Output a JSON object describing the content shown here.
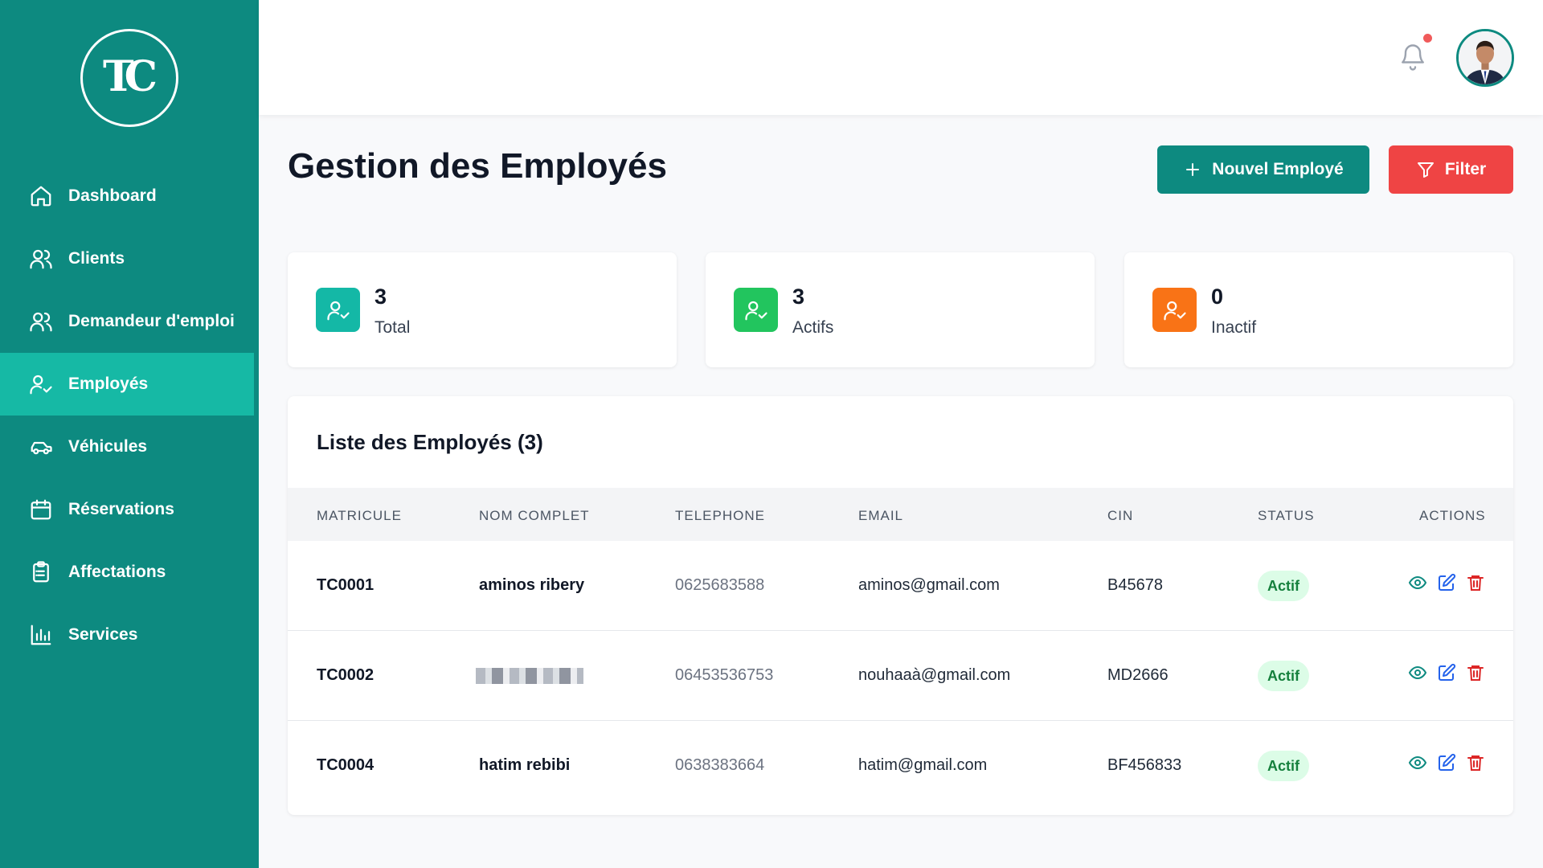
{
  "brand": {
    "logo_text": "TC"
  },
  "sidebar": {
    "items": [
      {
        "label": "Dashboard",
        "icon": "home-icon"
      },
      {
        "label": "Clients",
        "icon": "users-icon"
      },
      {
        "label": "Demandeur d'emploi",
        "icon": "users-icon"
      },
      {
        "label": "Employés",
        "icon": "user-check-icon",
        "active": true
      },
      {
        "label": "Véhicules",
        "icon": "car-icon"
      },
      {
        "label": "Réservations",
        "icon": "calendar-icon"
      },
      {
        "label": "Affectations",
        "icon": "clipboard-list-icon"
      },
      {
        "label": "Services",
        "icon": "bar-chart-icon"
      }
    ]
  },
  "header": {
    "notification_icon": "bell-icon",
    "has_notification": true
  },
  "page": {
    "title": "Gestion des Employés",
    "new_button_label": "Nouvel Employé",
    "filter_button_label": "Filter"
  },
  "stats": [
    {
      "value": "3",
      "label": "Total",
      "color": "#14b8a6"
    },
    {
      "value": "3",
      "label": "Actifs",
      "color": "#22c55e"
    },
    {
      "value": "0",
      "label": "Inactif",
      "color": "#f97316"
    }
  ],
  "table": {
    "title": "Liste des Employés (3)",
    "columns": [
      "MATRICULE",
      "NOM COMPLET",
      "TELEPHONE",
      "EMAIL",
      "CIN",
      "STATUS",
      "ACTIONS"
    ],
    "rows": [
      {
        "matricule": "TC0001",
        "nom": "aminos ribery",
        "telephone": "0625683588",
        "email": "aminos@gmail.com",
        "cin": "B45678",
        "status": "Actif"
      },
      {
        "matricule": "TC0002",
        "nom": "",
        "telephone": "06453536753",
        "email": "nouhaaà@gmail.com",
        "cin": "MD2666",
        "status": "Actif"
      },
      {
        "matricule": "TC0004",
        "nom": "hatim rebibi",
        "telephone": "0638383664",
        "email": "hatim@gmail.com",
        "cin": "BF456833",
        "status": "Actif"
      }
    ]
  },
  "colors": {
    "sidebar": "#0d8a80",
    "sidebar_active": "#16b9a5",
    "primary": "#0d8a80",
    "danger": "#ef4444",
    "badge_bg": "#dcfce7",
    "badge_text": "#15803d"
  }
}
